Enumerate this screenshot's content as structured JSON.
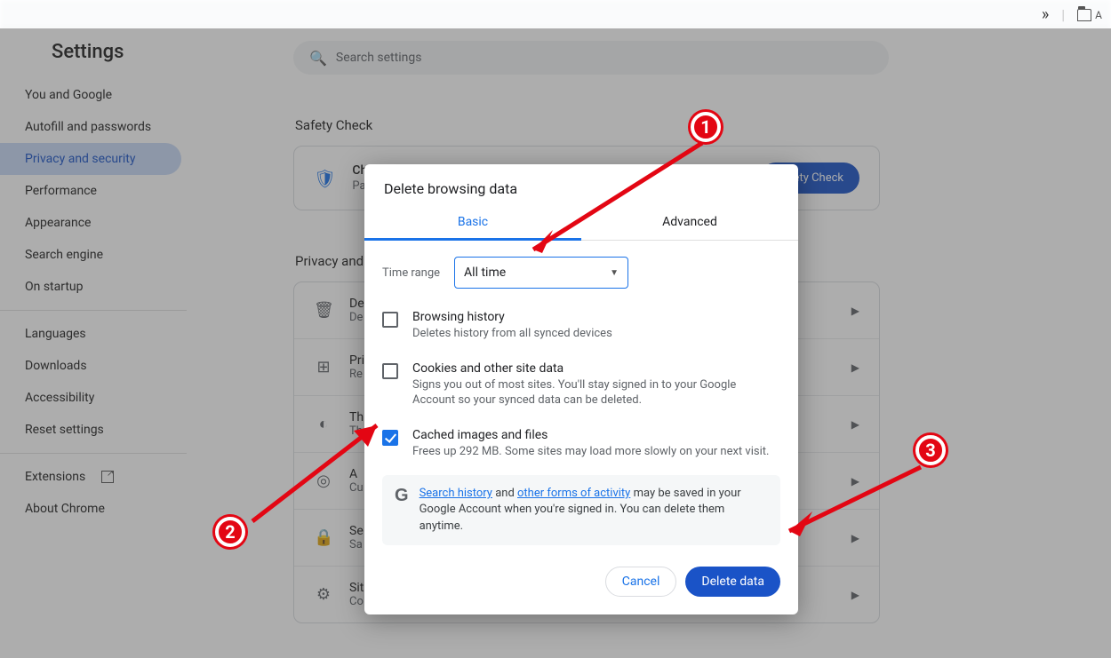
{
  "app": {
    "title": "Settings"
  },
  "sidebar": {
    "items": [
      {
        "label": "You and Google"
      },
      {
        "label": "Autofill and passwords"
      },
      {
        "label": "Privacy and security"
      },
      {
        "label": "Performance"
      },
      {
        "label": "Appearance"
      },
      {
        "label": "Search engine"
      },
      {
        "label": "On startup"
      }
    ],
    "items2": [
      {
        "label": "Languages"
      },
      {
        "label": "Downloads"
      },
      {
        "label": "Accessibility"
      },
      {
        "label": "Reset settings"
      }
    ],
    "items3": [
      {
        "label": "Extensions"
      },
      {
        "label": "About Chrome"
      }
    ]
  },
  "search": {
    "placeholder": "Search settings"
  },
  "safety": {
    "section_label": "Safety Check",
    "heading": "Chrome found some safety recommendations for your review",
    "sub": "Pas",
    "button": "Safety Check"
  },
  "privacy": {
    "section_label": "Privacy and",
    "rows": [
      {
        "title": "De",
        "sub": "De"
      },
      {
        "title": "Pri",
        "sub": "Re"
      },
      {
        "title": "Th",
        "sub": "Th"
      },
      {
        "title": "A",
        "sub": "Cu"
      },
      {
        "title": "Se",
        "sub": "Sa"
      },
      {
        "title": "Sit",
        "sub": "Co"
      }
    ]
  },
  "dialog": {
    "title": "Delete browsing data",
    "tabs": {
      "basic": "Basic",
      "advanced": "Advanced"
    },
    "time_label": "Time range",
    "time_value": "All time",
    "options": [
      {
        "title": "Browsing history",
        "sub": "Deletes history from all synced devices",
        "checked": false
      },
      {
        "title": "Cookies and other site data",
        "sub": "Signs you out of most sites. You'll stay signed in to your Google Account so your synced data can be deleted.",
        "checked": false
      },
      {
        "title": "Cached images and files",
        "sub": "Frees up 292 MB. Some sites may load more slowly on your next visit.",
        "checked": true
      }
    ],
    "info": {
      "link1": "Search history",
      "mid": " and ",
      "link2": "other forms of activity",
      "rest": " may be saved in your Google Account when you're signed in. You can delete them anytime."
    },
    "cancel": "Cancel",
    "delete": "Delete data"
  },
  "tabstrip": {
    "folder_letter": "A"
  },
  "markers": {
    "m1": "1",
    "m2": "2",
    "m3": "3"
  }
}
